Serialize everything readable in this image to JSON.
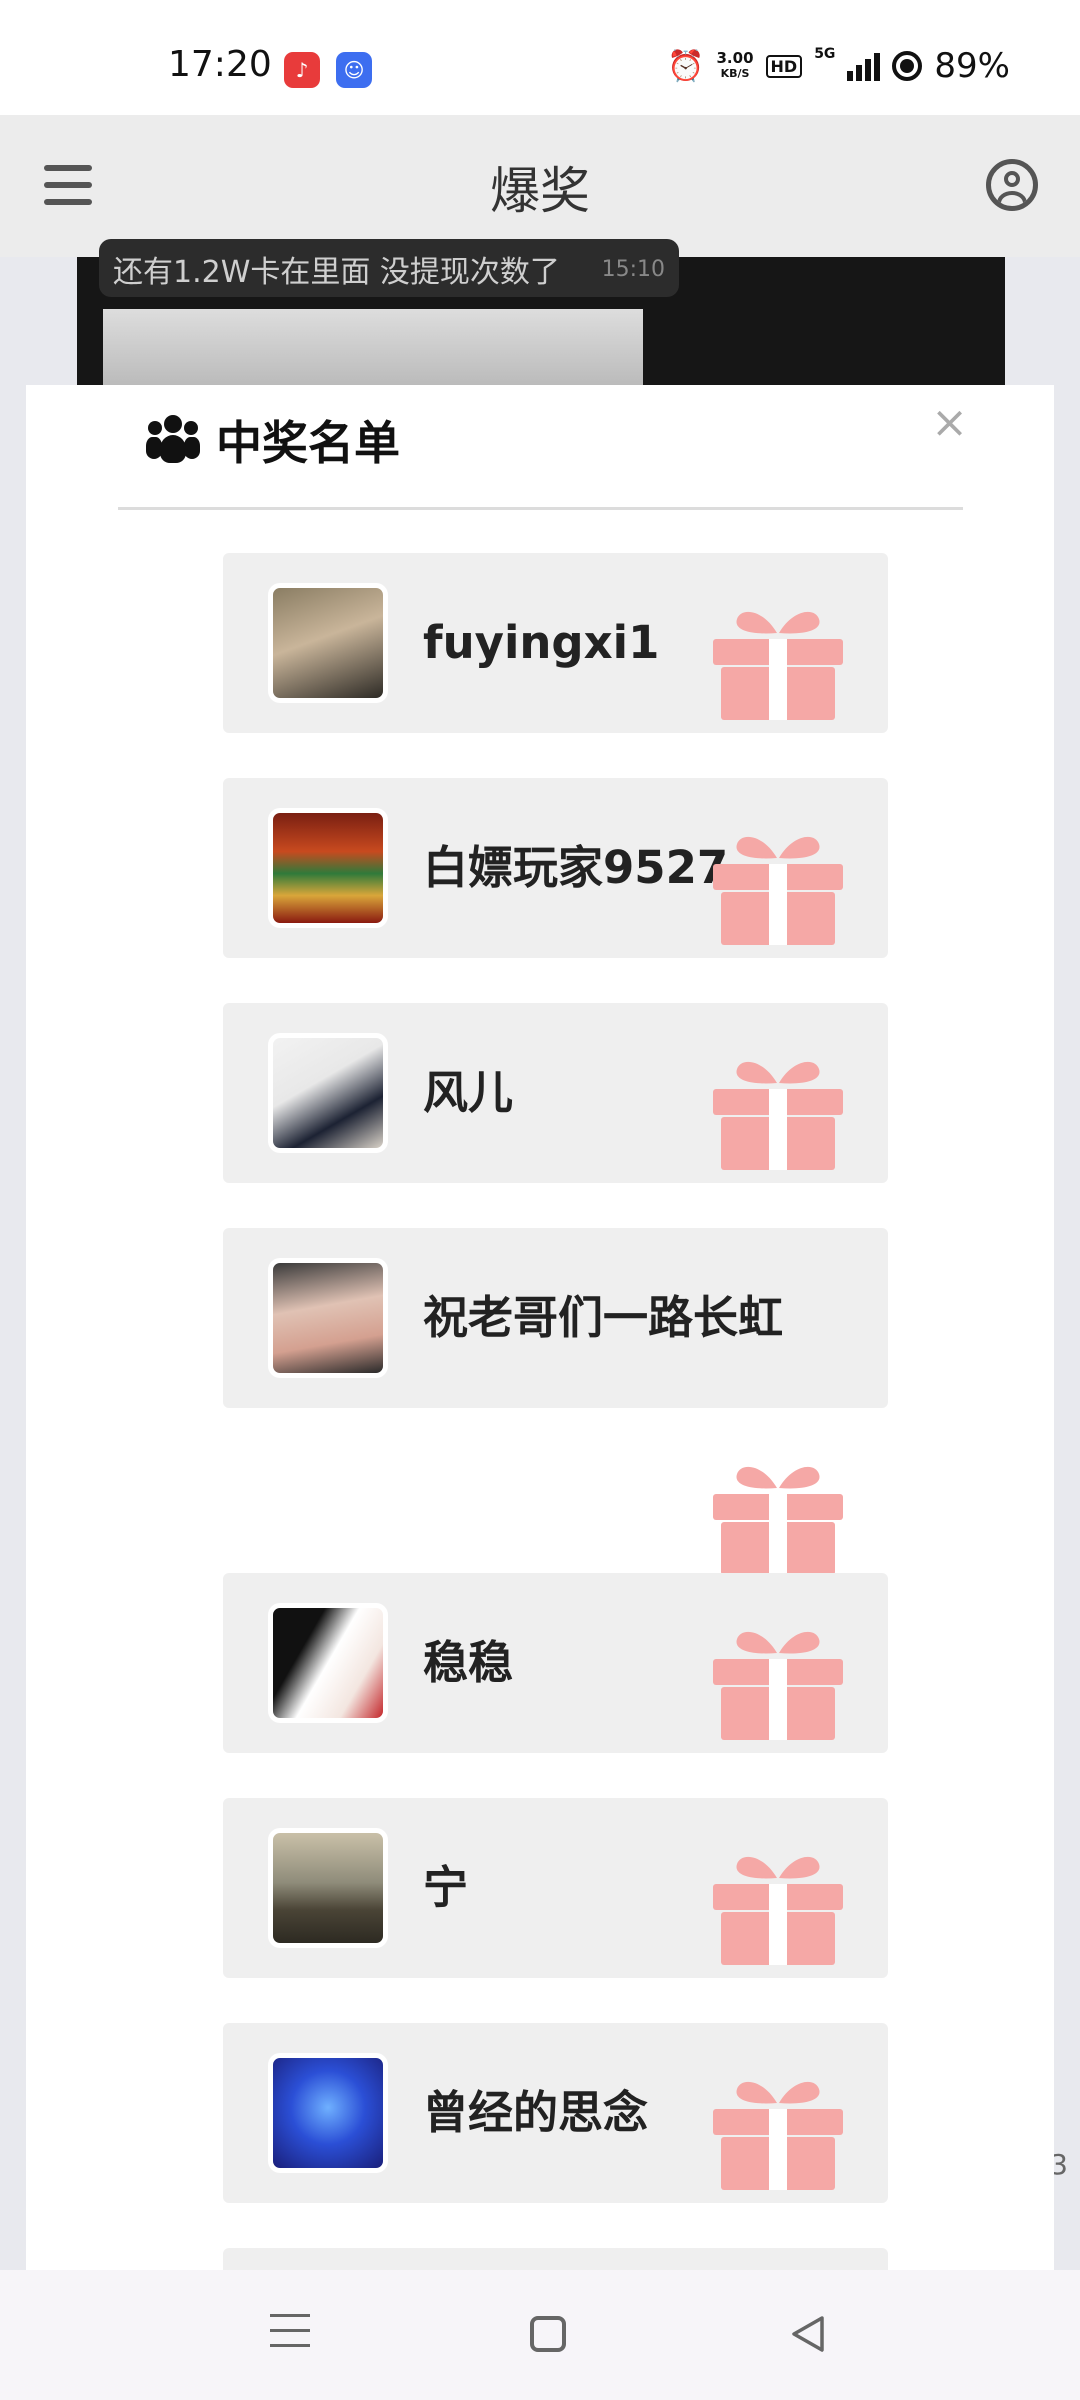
{
  "status_bar": {
    "time": "17:20",
    "net_speed_value": "3.00",
    "net_speed_unit": "KB/S",
    "hd": "HD",
    "network": "5G",
    "battery": "89%",
    "icons": [
      "music-app-icon",
      "chat-app-icon",
      "alarm-icon",
      "signal-icon",
      "battery-icon"
    ]
  },
  "header": {
    "title": "爆奖",
    "menu_icon": "hamburger-menu-icon",
    "user_icon": "user-account-icon"
  },
  "background": {
    "message_text": "还有1.2W卡在里面 没提现次数了",
    "message_time": "15:10",
    "side_number": "3"
  },
  "modal": {
    "title": "中奖名单",
    "title_icon": "users-group-icon",
    "close_label": "×",
    "winners": [
      {
        "name": "fuyingxi1"
      },
      {
        "name": "白嫖玩家9527"
      },
      {
        "name": "风儿"
      },
      {
        "name": "祝老哥们一路长虹"
      },
      {
        "name": "稳稳"
      },
      {
        "name": "宁"
      },
      {
        "name": "曾经的思念"
      }
    ],
    "gift_icon": "gift-icon",
    "gift_color": "#f5a8a6"
  },
  "nav_bar": {
    "icons": [
      "recent-apps-icon",
      "home-icon",
      "back-icon"
    ]
  }
}
